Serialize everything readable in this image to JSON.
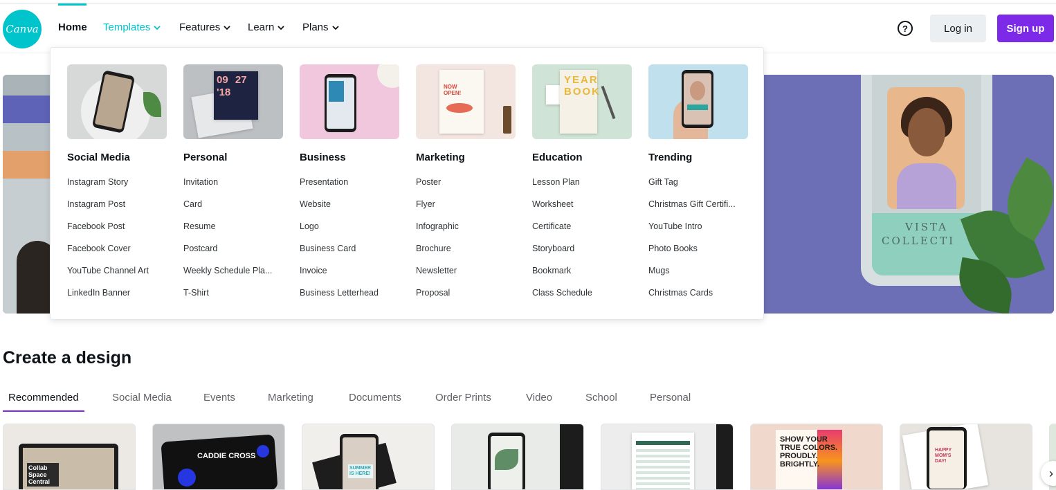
{
  "header": {
    "logo_text": "Canva",
    "nav": {
      "home": "Home",
      "templates": "Templates",
      "features": "Features",
      "learn": "Learn",
      "plans": "Plans"
    },
    "help_symbol": "?",
    "login": "Log in",
    "signup": "Sign up"
  },
  "colors": {
    "brand_teal": "#00c4cc",
    "brand_purple": "#7d2ae8"
  },
  "templates_menu": {
    "columns": [
      {
        "title": "Social Media",
        "items": [
          "Instagram Story",
          "Instagram Post",
          "Facebook Post",
          "Facebook Cover",
          "YouTube Channel Art",
          "LinkedIn Banner"
        ]
      },
      {
        "title": "Personal",
        "items": [
          "Invitation",
          "Card",
          "Resume",
          "Postcard",
          "Weekly Schedule Pla...",
          "T-Shirt"
        ]
      },
      {
        "title": "Business",
        "items": [
          "Presentation",
          "Website",
          "Logo",
          "Business Card",
          "Invoice",
          "Business Letterhead"
        ]
      },
      {
        "title": "Marketing",
        "items": [
          "Poster",
          "Flyer",
          "Infographic",
          "Brochure",
          "Newsletter",
          "Proposal"
        ]
      },
      {
        "title": "Education",
        "items": [
          "Lesson Plan",
          "Worksheet",
          "Certificate",
          "Storyboard",
          "Bookmark",
          "Class Schedule"
        ]
      },
      {
        "title": "Trending",
        "items": [
          "Gift Tag",
          "Christmas Gift Certifi...",
          "YouTube Intro",
          "Photo Books",
          "Mugs",
          "Christmas Cards"
        ]
      }
    ],
    "thumb_text": {
      "personal_date": "09 27 '18",
      "marketing_poster": "NOW OPEN!",
      "education_yearbook": "YEAR BOOK"
    }
  },
  "hero": {
    "phone_text_line1": "VISTA",
    "phone_text_line2": "COLLECTI"
  },
  "create": {
    "title": "Create a design",
    "tabs": [
      "Recommended",
      "Social Media",
      "Events",
      "Marketing",
      "Documents",
      "Order Prints",
      "Video",
      "School",
      "Personal"
    ],
    "card_text": {
      "c1": "Collab Space Central",
      "c2": "CADDIE CROSS",
      "c3": "SUMMER IS HERE!",
      "c6": "SHOW YOUR TRUE COLORS. PROUDLY. BRIGHTLY.",
      "c7": "HAPPY MOM'S DAY!"
    },
    "next_arrow": "›"
  }
}
